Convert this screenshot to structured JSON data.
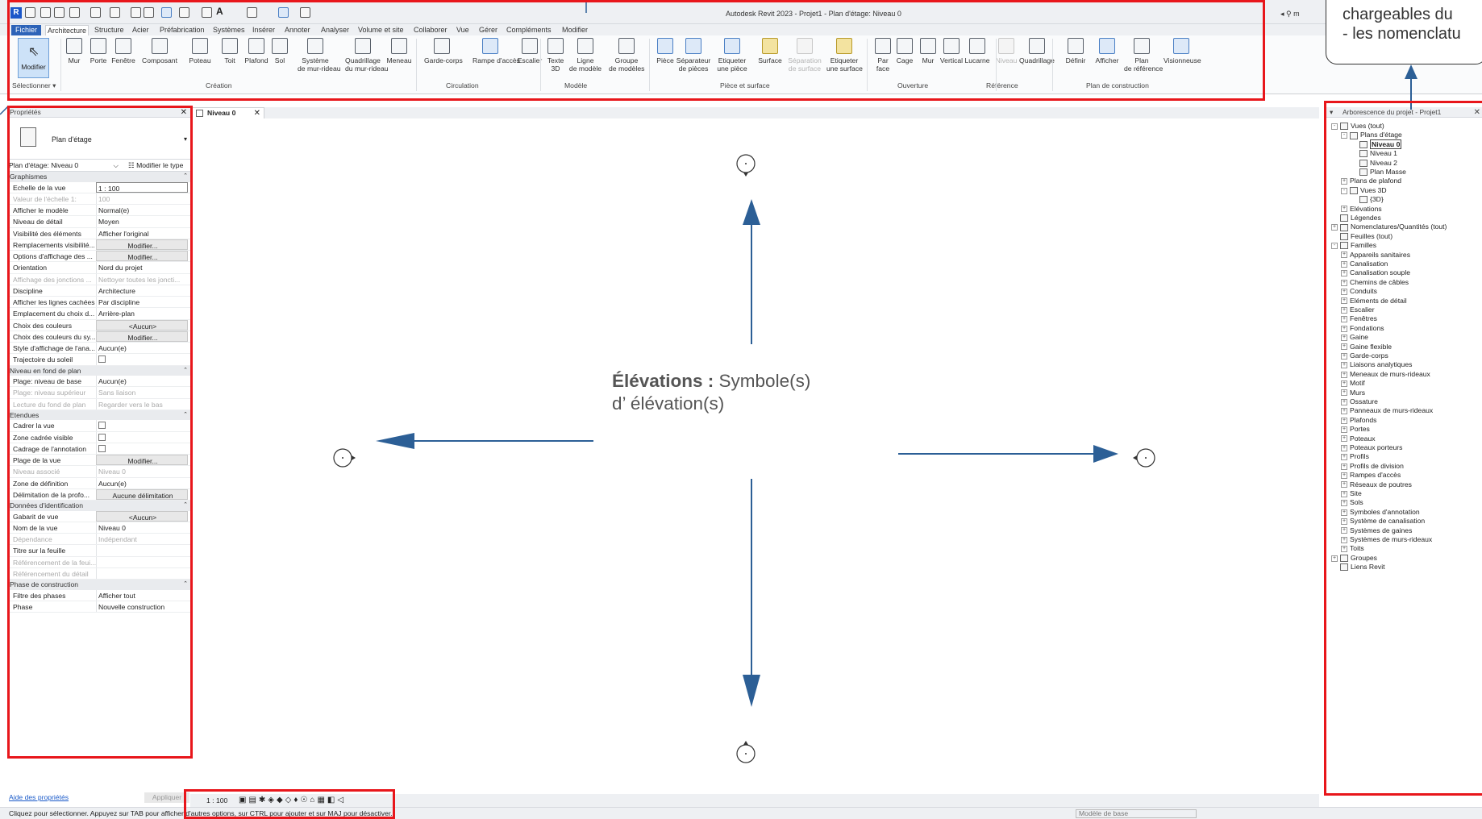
{
  "window": {
    "title": "Autodesk Revit 2023 - Projet1 - Plan d'étage: Niveau 0",
    "user": "m"
  },
  "menu_tabs": [
    "Fichier",
    "Architecture",
    "Structure",
    "Acier",
    "Préfabrication",
    "Systèmes",
    "Insérer",
    "Annoter",
    "Analyser",
    "Volume et site",
    "Collaborer",
    "Vue",
    "Gérer",
    "Compléments",
    "Modifier"
  ],
  "ribbon": {
    "modify": "Modifier",
    "select_panel": "Sélectionner",
    "buttons": [
      {
        "l1": "Mur",
        "l2": ""
      },
      {
        "l1": "Porte",
        "l2": ""
      },
      {
        "l1": "Fenêtre",
        "l2": ""
      },
      {
        "l1": "Composant",
        "l2": ""
      },
      {
        "l1": "Poteau",
        "l2": ""
      },
      {
        "l1": "Toit",
        "l2": ""
      },
      {
        "l1": "Plafond",
        "l2": ""
      },
      {
        "l1": "Sol",
        "l2": ""
      },
      {
        "l1": "Système",
        "l2": "de mur-rideau"
      },
      {
        "l1": "Quadrillage",
        "l2": "du mur-rideau"
      },
      {
        "l1": "Meneau",
        "l2": ""
      },
      {
        "l1": "Garde-corps",
        "l2": ""
      },
      {
        "l1": "Rampe d'accès",
        "l2": ""
      },
      {
        "l1": "Escalier",
        "l2": ""
      },
      {
        "l1": "Texte",
        "l2": "3D"
      },
      {
        "l1": "Ligne",
        "l2": "de modèle"
      },
      {
        "l1": "Groupe",
        "l2": "de modèles"
      },
      {
        "l1": "Pièce",
        "l2": ""
      },
      {
        "l1": "Séparateur",
        "l2": "de pièces"
      },
      {
        "l1": "Etiqueter",
        "l2": "une pièce"
      },
      {
        "l1": "Surface",
        "l2": ""
      },
      {
        "l1": "Séparation",
        "l2": "de surface"
      },
      {
        "l1": "Etiqueter",
        "l2": "une surface"
      },
      {
        "l1": "Par",
        "l2": "face"
      },
      {
        "l1": "Cage",
        "l2": ""
      },
      {
        "l1": "Mur",
        "l2": ""
      },
      {
        "l1": "Vertical",
        "l2": ""
      },
      {
        "l1": "Lucarne",
        "l2": ""
      },
      {
        "l1": "Niveau",
        "l2": ""
      },
      {
        "l1": "Quadrillage",
        "l2": ""
      },
      {
        "l1": "Définir",
        "l2": ""
      },
      {
        "l1": "Afficher",
        "l2": ""
      },
      {
        "l1": "Plan",
        "l2": "de référence"
      },
      {
        "l1": "Visionneuse",
        "l2": ""
      }
    ],
    "panels": [
      "Création",
      "Circulation",
      "Modèle",
      "Pièce et surface",
      "Ouverture",
      "Référence",
      "Plan de construction"
    ]
  },
  "properties": {
    "title": "Propriétés",
    "type_name": "Plan d'étage",
    "instance": "Plan d'étage: Niveau 0",
    "edit_type": "Modifier le type",
    "help": "Aide des propriétés",
    "apply": "Appliquer",
    "groups": [
      {
        "name": "Graphismes",
        "rows": [
          [
            "Echelle de la vue",
            "1 : 100",
            "inp"
          ],
          [
            "Valeur de l'échelle   1:",
            "100",
            "dis"
          ],
          [
            "Afficher le modèle",
            "Normal(e)",
            ""
          ],
          [
            "Niveau de détail",
            "Moyen",
            ""
          ],
          [
            "Visibilité des éléments",
            "Afficher l'original",
            ""
          ],
          [
            "Remplacements visibilité...",
            "Modifier...",
            "btn"
          ],
          [
            "Options d'affichage des ...",
            "Modifier...",
            "btn"
          ],
          [
            "Orientation",
            "Nord du projet",
            ""
          ],
          [
            "Affichage des jonctions ...",
            "Nettoyer toutes les joncti...",
            "dis"
          ],
          [
            "Discipline",
            "Architecture",
            ""
          ],
          [
            "Afficher les lignes cachées",
            "Par discipline",
            ""
          ],
          [
            "Emplacement du choix d...",
            "Arrière-plan",
            ""
          ],
          [
            "Choix des couleurs",
            "<Aucun>",
            "btn"
          ],
          [
            "Choix des couleurs du sy...",
            "Modifier...",
            "btn"
          ],
          [
            "Style d'affichage de l'ana...",
            "Aucun(e)",
            ""
          ],
          [
            "Trajectoire du soleil",
            "",
            "chk"
          ]
        ]
      },
      {
        "name": "Niveau en fond de plan",
        "rows": [
          [
            "Plage: niveau de base",
            "Aucun(e)",
            ""
          ],
          [
            "Plage: niveau supérieur",
            "Sans liaison",
            "dis"
          ],
          [
            "Lecture du fond de plan",
            "Regarder vers le bas",
            "dis"
          ]
        ]
      },
      {
        "name": "Etendues",
        "rows": [
          [
            "Cadrer la vue",
            "",
            "chk"
          ],
          [
            "Zone cadrée visible",
            "",
            "chk"
          ],
          [
            "Cadrage de l'annotation",
            "",
            "chk"
          ],
          [
            "Plage de la vue",
            "Modifier...",
            "btn"
          ],
          [
            "Niveau associé",
            "Niveau 0",
            "dis"
          ],
          [
            "Zone de définition",
            "Aucun(e)",
            ""
          ],
          [
            "Délimitation de la profo...",
            "Aucune délimitation",
            "btn"
          ]
        ]
      },
      {
        "name": "Données d'identification",
        "rows": [
          [
            "Gabarit de vue",
            "<Aucun>",
            "btn"
          ],
          [
            "Nom de la vue",
            "Niveau 0",
            ""
          ],
          [
            "Dépendance",
            "Indépendant",
            "dis"
          ],
          [
            "Titre sur la feuille",
            "",
            ""
          ],
          [
            "Référencement de la feui...",
            "",
            "dis"
          ],
          [
            "Référencement du détail",
            "",
            "dis"
          ]
        ]
      },
      {
        "name": "Phase de construction",
        "rows": [
          [
            "Filtre des phases",
            "Afficher tout",
            ""
          ],
          [
            "Phase",
            "Nouvelle construction",
            ""
          ]
        ]
      }
    ]
  },
  "view": {
    "tab": "Niveau 0",
    "scale": "1 : 100",
    "annotation_bold": "Élévations :",
    "annotation_rest": " Symbole(s)",
    "annotation_line2": "d’ élévation(s)"
  },
  "browser": {
    "title": "Arborescence du projet - Projet1",
    "nodes": [
      {
        "t": "Vues (tout)",
        "d": 0,
        "e": "-"
      },
      {
        "t": "Plans d'étage",
        "d": 1,
        "e": "-"
      },
      {
        "t": "Niveau 0",
        "d": 2,
        "e": "",
        "sel": true
      },
      {
        "t": "Niveau 1",
        "d": 2,
        "e": ""
      },
      {
        "t": "Niveau 2",
        "d": 2,
        "e": ""
      },
      {
        "t": "Plan Masse",
        "d": 2,
        "e": ""
      },
      {
        "t": "Plans de plafond",
        "d": 1,
        "e": "+"
      },
      {
        "t": "Vues 3D",
        "d": 1,
        "e": "-"
      },
      {
        "t": "{3D}",
        "d": 2,
        "e": ""
      },
      {
        "t": "Elévations",
        "d": 1,
        "e": "+"
      },
      {
        "t": "Légendes",
        "d": 0,
        "e": ""
      },
      {
        "t": "Nomenclatures/Quantités (tout)",
        "d": 0,
        "e": "+"
      },
      {
        "t": "Feuilles (tout)",
        "d": 0,
        "e": ""
      },
      {
        "t": "Familles",
        "d": 0,
        "e": "-"
      },
      {
        "t": "Appareils sanitaires",
        "d": 1,
        "e": "+"
      },
      {
        "t": "Canalisation",
        "d": 1,
        "e": "+"
      },
      {
        "t": "Canalisation souple",
        "d": 1,
        "e": "+"
      },
      {
        "t": "Chemins de câbles",
        "d": 1,
        "e": "+"
      },
      {
        "t": "Conduits",
        "d": 1,
        "e": "+"
      },
      {
        "t": "Eléments de détail",
        "d": 1,
        "e": "+"
      },
      {
        "t": "Escalier",
        "d": 1,
        "e": "+"
      },
      {
        "t": "Fenêtres",
        "d": 1,
        "e": "+"
      },
      {
        "t": "Fondations",
        "d": 1,
        "e": "+"
      },
      {
        "t": "Gaine",
        "d": 1,
        "e": "+"
      },
      {
        "t": "Gaine flexible",
        "d": 1,
        "e": "+"
      },
      {
        "t": "Garde-corps",
        "d": 1,
        "e": "+"
      },
      {
        "t": "Liaisons analytiques",
        "d": 1,
        "e": "+"
      },
      {
        "t": "Meneaux de murs-rideaux",
        "d": 1,
        "e": "+"
      },
      {
        "t": "Motif",
        "d": 1,
        "e": "+"
      },
      {
        "t": "Murs",
        "d": 1,
        "e": "+"
      },
      {
        "t": "Ossature",
        "d": 1,
        "e": "+"
      },
      {
        "t": "Panneaux de murs-rideaux",
        "d": 1,
        "e": "+"
      },
      {
        "t": "Plafonds",
        "d": 1,
        "e": "+"
      },
      {
        "t": "Portes",
        "d": 1,
        "e": "+"
      },
      {
        "t": "Poteaux",
        "d": 1,
        "e": "+"
      },
      {
        "t": "Poteaux porteurs",
        "d": 1,
        "e": "+"
      },
      {
        "t": "Profils",
        "d": 1,
        "e": "+"
      },
      {
        "t": "Profils de division",
        "d": 1,
        "e": "+"
      },
      {
        "t": "Rampes d'accès",
        "d": 1,
        "e": "+"
      },
      {
        "t": "Réseaux de poutres",
        "d": 1,
        "e": "+"
      },
      {
        "t": "Site",
        "d": 1,
        "e": "+"
      },
      {
        "t": "Sols",
        "d": 1,
        "e": "+"
      },
      {
        "t": "Symboles d'annotation",
        "d": 1,
        "e": "+"
      },
      {
        "t": "Système de canalisation",
        "d": 1,
        "e": "+"
      },
      {
        "t": "Systèmes de gaines",
        "d": 1,
        "e": "+"
      },
      {
        "t": "Systèmes de murs-rideaux",
        "d": 1,
        "e": "+"
      },
      {
        "t": "Toits",
        "d": 1,
        "e": "+"
      },
      {
        "t": "Groupes",
        "d": 0,
        "e": "+"
      },
      {
        "t": "Liens Revit",
        "d": 0,
        "e": ""
      }
    ]
  },
  "callout": {
    "line1": "chargeables du",
    "line2": "- les nomenclatu"
  },
  "status": {
    "text": "Cliquez pour sélectionner. Appuyez sur TAB pour afficher d'autres options, sur CTRL pour ajouter et sur MAJ pour désactiver.",
    "model": "Modèle de base"
  },
  "colors": {
    "highlight": "#e8161b",
    "arrow": "#2c5f96",
    "accent": "#2d63b8"
  }
}
